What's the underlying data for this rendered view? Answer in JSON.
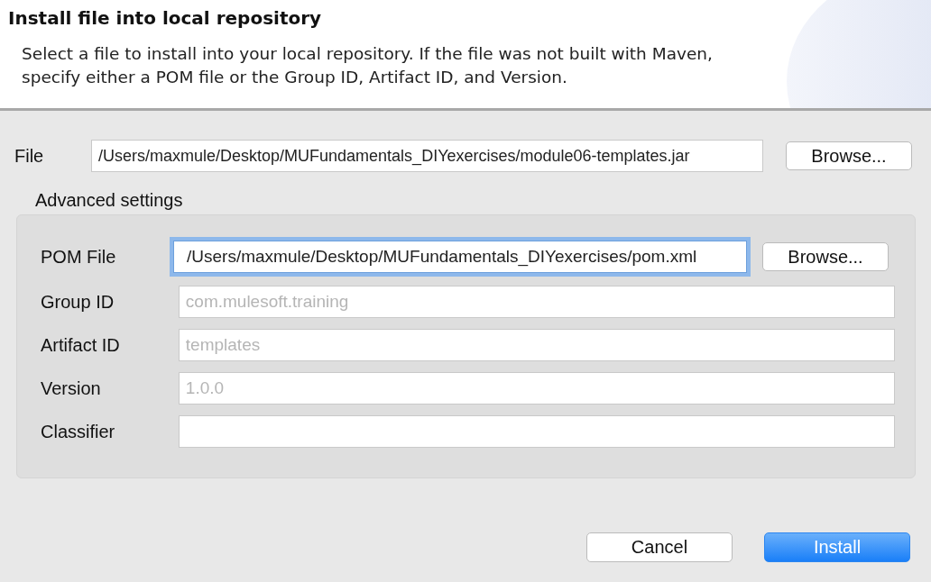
{
  "header": {
    "title": "Install file into local repository",
    "description": "Select a file to install into your local repository. If the file was not built with Maven, specify either a POM file or the Group ID, Artifact ID, and Version."
  },
  "file": {
    "label": "File",
    "value": "/Users/maxmule/Desktop/MUFundamentals_DIYexercises/module06-templates.jar",
    "button": "Browse..."
  },
  "advanced": {
    "title": "Advanced settings",
    "fields": [
      {
        "label": "POM File",
        "value": "/Users/maxmule/Desktop/MUFundamentals_DIYexercises/pom.xml",
        "focused": true,
        "button": "Browse..."
      },
      {
        "label": "Group ID",
        "placeholder": "com.mulesoft.training",
        "focused": false
      },
      {
        "label": "Artifact ID",
        "placeholder": "templates",
        "focused": false
      },
      {
        "label": "Version",
        "placeholder": "1.0.0",
        "focused": false
      },
      {
        "label": "Classifier",
        "focused": false
      }
    ]
  },
  "buttons": [
    {
      "label": "Cancel",
      "kind": "default"
    },
    {
      "label": "Install",
      "kind": "primary"
    }
  ]
}
